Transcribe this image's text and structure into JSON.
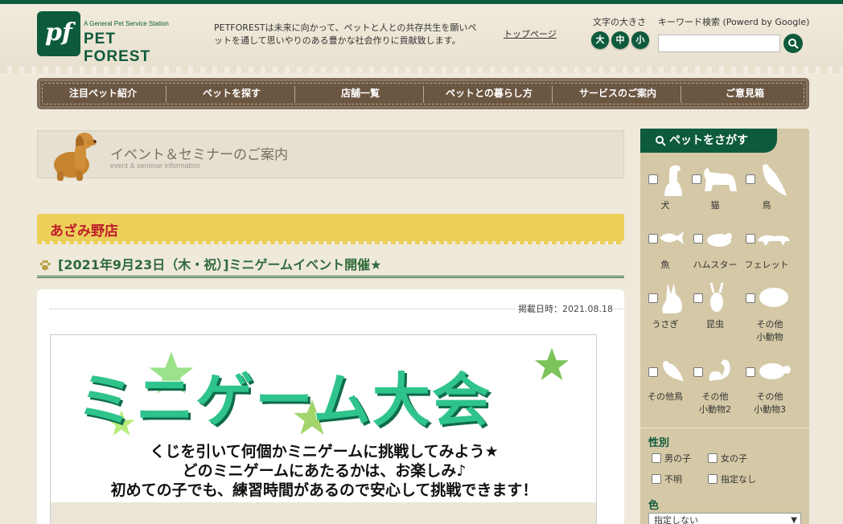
{
  "header": {
    "logo_tag": "A General Pet Service Station",
    "logo_name": "PET FOREST",
    "logo_mark": "pf",
    "tagline": "PETFORESTは未来に向かって、ペットと人との共存共生を願いペットを通して思いやりのある豊かな社会作りに貢献致します。",
    "top_link": "トップページ",
    "font_size_label": "文字の大きさ",
    "font_sizes": [
      "大",
      "中",
      "小"
    ],
    "search_label": "キーワード検索 (Powerd by Google)",
    "search_value": ""
  },
  "nav": {
    "items": [
      "注目ペット紹介",
      "ペットを探す",
      "店舗一覧",
      "ペットとの暮らし方",
      "サービスのご案内",
      "ご意見箱"
    ]
  },
  "main": {
    "banner_title": "イベント＆セミナーのご案内",
    "banner_sub": "event & seminar information",
    "store_name": "あざみ野店",
    "event_title": "[2021年9月23日（木・祝）]ミニゲームイベント開催★",
    "posted_date": "掲載日時：2021.08.18",
    "flyer": {
      "title": "ミニゲーム大会",
      "line1": "くじを引いて何個かミニゲームに挑戦してみよう★",
      "line2": "どのミニゲームにあたるかは、お楽しみ♪",
      "line3": "初めての子でも、練習時間があるので安心して挑戦できます！"
    }
  },
  "sidebar": {
    "title": "ペットをさがす",
    "pets": [
      {
        "label": "犬",
        "icon": "dog-icon"
      },
      {
        "label": "猫",
        "icon": "cat-icon"
      },
      {
        "label": "鳥",
        "icon": "bird-icon"
      },
      {
        "label": "魚",
        "icon": "fish-icon"
      },
      {
        "label": "ハムスター",
        "icon": "hamster-icon"
      },
      {
        "label": "フェレット",
        "icon": "ferret-icon"
      },
      {
        "label": "うさぎ",
        "icon": "rabbit-icon"
      },
      {
        "label": "昆虫",
        "icon": "beetle-icon"
      },
      {
        "label": "その他\n小動物",
        "icon": "small-animal-icon"
      },
      {
        "label": "その他鳥",
        "icon": "other-bird-icon"
      },
      {
        "label": "その他\n小動物2",
        "icon": "squirrel-icon"
      },
      {
        "label": "その他\n小動物3",
        "icon": "turtle-icon"
      }
    ],
    "gender_title": "性別",
    "gender_options": [
      "男の子",
      "女の子",
      "不明",
      "指定なし"
    ],
    "color_title": "色",
    "color_selected": "指定しない"
  },
  "colors": {
    "brand_green": "#0e5a3c",
    "nav_brown": "#6b5642",
    "store_yellow": "#ecd05a",
    "store_red": "#c01c2a"
  }
}
